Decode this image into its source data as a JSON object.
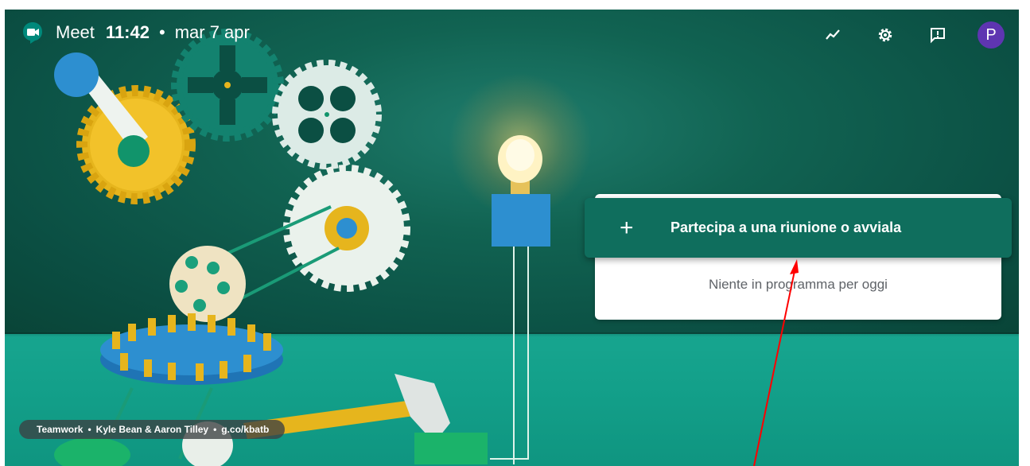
{
  "topbar": {
    "app_name": "Meet",
    "time": "11:42",
    "separator": "•",
    "date": "mar 7 apr",
    "icons": [
      "activity-icon",
      "gear-icon",
      "feedback-icon"
    ],
    "avatar_initial": "P"
  },
  "main": {
    "join_plus": "+",
    "join_label": "Partecipa a una riunione o avviala",
    "empty_text": "Niente in programma per oggi"
  },
  "credit": {
    "title": "Teamwork",
    "dot1": "•",
    "artists": "Kyle Bean & Aaron Tilley",
    "dot2": "•",
    "link": "g.co/kbatb"
  },
  "colors": {
    "accent": "#0f6e5d",
    "avatar": "#5e35b1",
    "annotation": "#ff0000"
  }
}
